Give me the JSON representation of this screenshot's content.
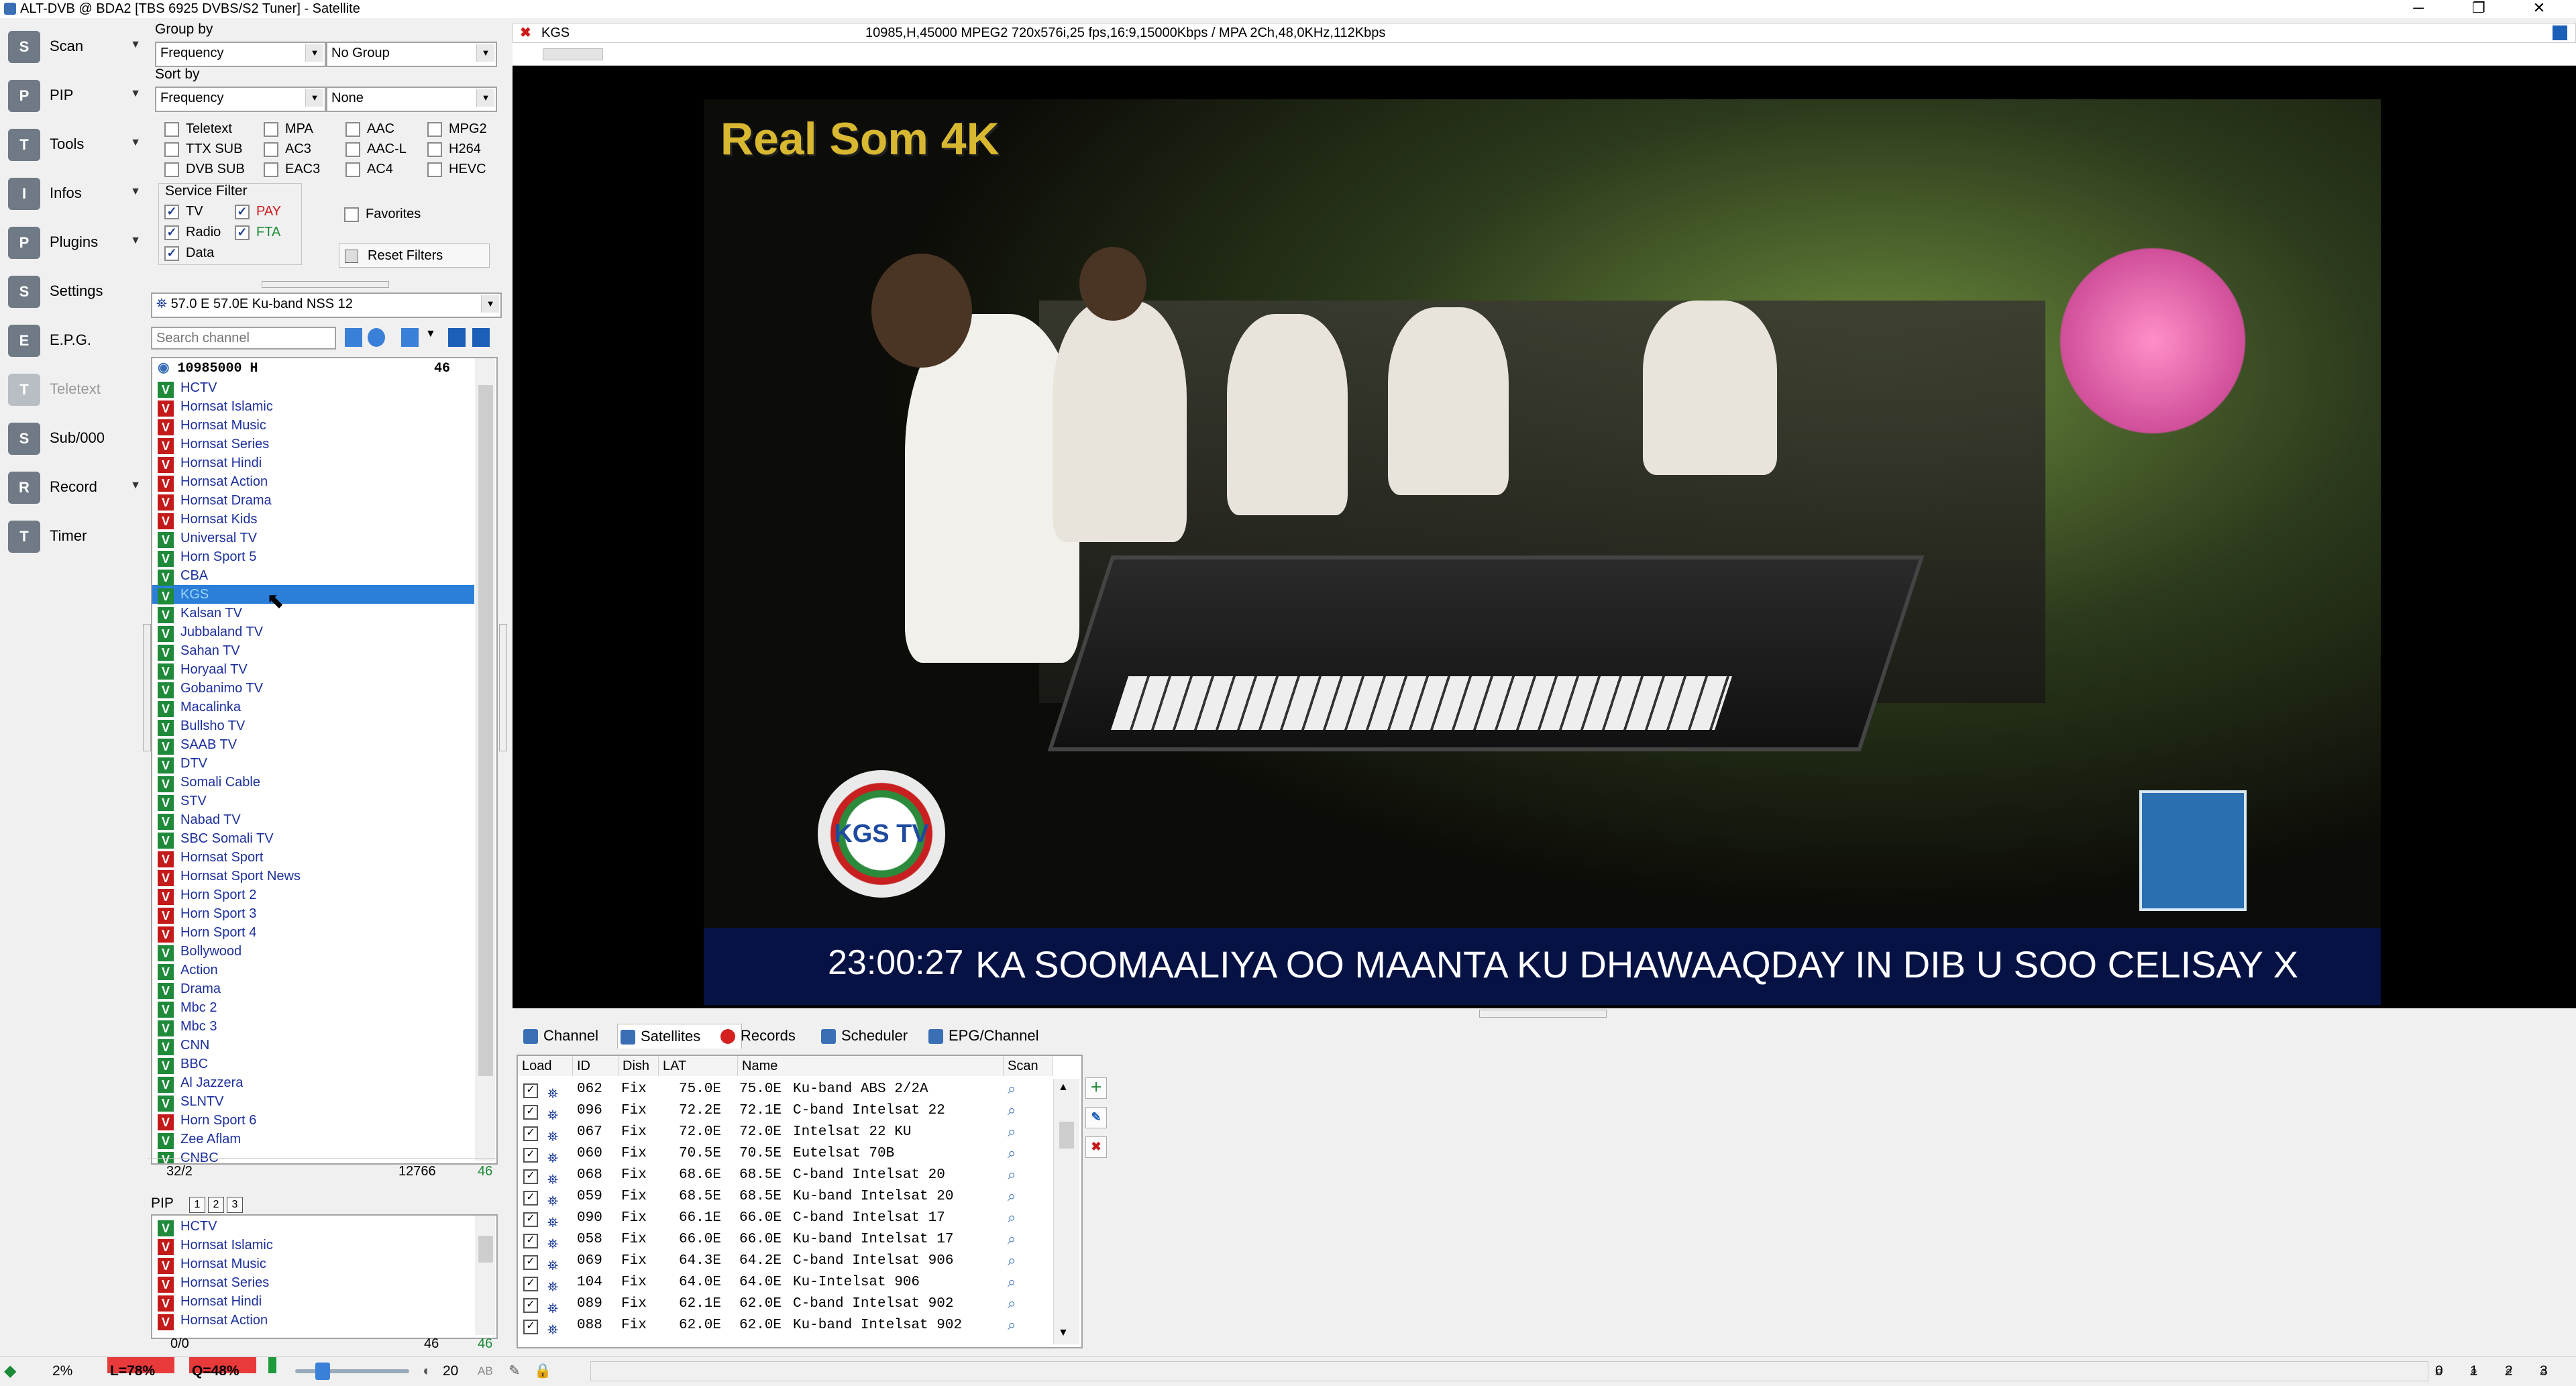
{
  "window": {
    "title": "ALT-DVB @ BDA2 [TBS 6925 DVBS/S2 Tuner] - Satellite"
  },
  "toolbar": [
    {
      "label": "Scan",
      "icon": "scan-icon",
      "arrow": "▼",
      "dim": false
    },
    {
      "label": "PIP",
      "icon": "pip-icon",
      "arrow": "▼",
      "dim": false
    },
    {
      "label": "Tools",
      "icon": "tools-icon",
      "arrow": "▼",
      "dim": false
    },
    {
      "label": "Infos",
      "icon": "info-icon",
      "arrow": "▼",
      "dim": false
    },
    {
      "label": "Plugins",
      "icon": "plugins-icon",
      "arrow": "▼",
      "dim": false
    },
    {
      "label": "Settings",
      "icon": "gear-icon",
      "arrow": "",
      "dim": false
    },
    {
      "label": "E.P.G.",
      "icon": "epg-icon",
      "arrow": "",
      "dim": false
    },
    {
      "label": "Teletext",
      "icon": "teletext-icon",
      "arrow": "",
      "dim": true
    },
    {
      "label": "Sub/000",
      "icon": "subtitle-icon",
      "arrow": "",
      "dim": false
    },
    {
      "label": "Record",
      "icon": "record-icon",
      "arrow": "▼",
      "dim": false
    },
    {
      "label": "Timer",
      "icon": "timer-icon",
      "arrow": "",
      "dim": false
    }
  ],
  "filters": {
    "group_by_label": "Group by",
    "group_by_value": "Frequency",
    "group_value2": "No Group",
    "sort_by_label": "Sort by",
    "sort_by_value": "Frequency",
    "sort_value2": "None",
    "checks": [
      {
        "label": "Teletext",
        "on": false
      },
      {
        "label": "MPA",
        "on": false
      },
      {
        "label": "AAC",
        "on": false
      },
      {
        "label": "MPG2",
        "on": false
      },
      {
        "label": "TTX SUB",
        "on": false
      },
      {
        "label": "AC3",
        "on": false
      },
      {
        "label": "AAC-L",
        "on": false
      },
      {
        "label": "H264",
        "on": false
      },
      {
        "label": "DVB SUB",
        "on": false
      },
      {
        "label": "EAC3",
        "on": false
      },
      {
        "label": "AC4",
        "on": false
      },
      {
        "label": "HEVC",
        "on": false
      }
    ],
    "service_filter_label": "Service Filter",
    "service": [
      {
        "label": "TV",
        "on": true,
        "color": ""
      },
      {
        "label": "PAY",
        "on": true,
        "color": "red"
      },
      {
        "label": "Radio",
        "on": true,
        "color": ""
      },
      {
        "label": "FTA",
        "on": true,
        "color": "grn"
      },
      {
        "label": "Data",
        "on": true,
        "color": ""
      }
    ],
    "favorites_label": "Favorites",
    "reset_label": "Reset Filters"
  },
  "satellite_select": "57.0 E 57.0E Ku-band NSS 12",
  "search_placeholder": "Search channel",
  "transponder": {
    "label": "10985000 H",
    "count": "46"
  },
  "channels": [
    {
      "name": "HCTV",
      "t": "v"
    },
    {
      "name": "Hornsat Islamic",
      "t": "r"
    },
    {
      "name": "Hornsat Music",
      "t": "r"
    },
    {
      "name": "Hornsat Series",
      "t": "r"
    },
    {
      "name": "Hornsat Hindi",
      "t": "r"
    },
    {
      "name": "Hornsat Action",
      "t": "r"
    },
    {
      "name": "Hornsat Drama",
      "t": "r"
    },
    {
      "name": "Hornsat Kids",
      "t": "r"
    },
    {
      "name": "Universal TV",
      "t": "v"
    },
    {
      "name": "Horn Sport 5",
      "t": "v"
    },
    {
      "name": "CBA",
      "t": "v"
    },
    {
      "name": "KGS",
      "t": "v"
    },
    {
      "name": "Kalsan TV",
      "t": "v"
    },
    {
      "name": "Jubbaland TV",
      "t": "v"
    },
    {
      "name": "Sahan TV",
      "t": "v"
    },
    {
      "name": "Horyaal TV",
      "t": "v"
    },
    {
      "name": "Gobanimo TV",
      "t": "v"
    },
    {
      "name": "Macalinka",
      "t": "v"
    },
    {
      "name": "Bullsho TV",
      "t": "v"
    },
    {
      "name": "SAAB TV",
      "t": "v"
    },
    {
      "name": "DTV",
      "t": "v"
    },
    {
      "name": "Somali Cable",
      "t": "v"
    },
    {
      "name": "STV",
      "t": "v"
    },
    {
      "name": "Nabad TV",
      "t": "v"
    },
    {
      "name": "SBC Somali TV",
      "t": "v"
    },
    {
      "name": "Hornsat Sport",
      "t": "r"
    },
    {
      "name": "Hornsat Sport News",
      "t": "r"
    },
    {
      "name": "Horn Sport 2",
      "t": "r"
    },
    {
      "name": "Horn Sport 3",
      "t": "r"
    },
    {
      "name": "Horn Sport 4",
      "t": "r"
    },
    {
      "name": "Bollywood",
      "t": "v"
    },
    {
      "name": "Action",
      "t": "v"
    },
    {
      "name": "Drama",
      "t": "v"
    },
    {
      "name": "Mbc 2",
      "t": "v"
    },
    {
      "name": "Mbc 3",
      "t": "v"
    },
    {
      "name": "CNN",
      "t": "v"
    },
    {
      "name": "BBC",
      "t": "v"
    },
    {
      "name": "Al Jazzera",
      "t": "v"
    },
    {
      "name": "SLNTV",
      "t": "v"
    },
    {
      "name": "Horn Sport 6",
      "t": "r"
    },
    {
      "name": "Zee Aflam",
      "t": "v"
    },
    {
      "name": "CNBC",
      "t": "v"
    }
  ],
  "selected_channel_index": 11,
  "list_status": {
    "left": "32/2",
    "mid": "12766",
    "right": "46"
  },
  "pip": {
    "label": "PIP",
    "buttons": [
      "1",
      "2",
      "3"
    ],
    "channels": [
      {
        "name": "HCTV",
        "t": "v"
      },
      {
        "name": "Hornsat Islamic",
        "t": "r"
      },
      {
        "name": "Hornsat Music",
        "t": "r"
      },
      {
        "name": "Hornsat Series",
        "t": "r"
      },
      {
        "name": "Hornsat Hindi",
        "t": "r"
      },
      {
        "name": "Hornsat Action",
        "t": "r"
      }
    ],
    "status": {
      "left": "0/0",
      "mid": "46",
      "right": "46"
    }
  },
  "video": {
    "channel": "KGS",
    "stream_info": "10985,H,45000  MPEG2 720x576i,25 fps,16:9,15000Kbps / MPA 2Ch,48,0KHz,112Kbps",
    "logo_text": "Real Som 4K",
    "kgs_logo": "KGS TV",
    "time": "23:00:27",
    "ticker": "KA SOOMAALIYA OO MAANTA KU DHAWAAQDAY IN DIB U SOO CELISAY X"
  },
  "tabs": [
    {
      "label": "Channel",
      "icon": "channel-icon",
      "active": false
    },
    {
      "label": "Satellites",
      "icon": "satellite-icon",
      "active": true
    },
    {
      "label": "Records",
      "icon": "record-icon",
      "active": false
    },
    {
      "label": "Scheduler",
      "icon": "scheduler-icon",
      "active": false
    },
    {
      "label": "EPG/Channel",
      "icon": "epg-icon",
      "active": false
    }
  ],
  "sat_table": {
    "headers": [
      "Load",
      "ID",
      "Dish",
      "LAT",
      "Name",
      "Scan"
    ],
    "rows": [
      {
        "id": "062",
        "dish": "Fix",
        "lat": "75.0E",
        "lat2": "75.0E",
        "name": "Ku-band ABS 2/2A"
      },
      {
        "id": "096",
        "dish": "Fix",
        "lat": "72.2E",
        "lat2": "72.1E",
        "name": "C-band Intelsat 22"
      },
      {
        "id": "067",
        "dish": "Fix",
        "lat": "72.0E",
        "lat2": "72.0E",
        "name": "Intelsat 22 KU"
      },
      {
        "id": "060",
        "dish": "Fix",
        "lat": "70.5E",
        "lat2": "70.5E",
        "name": "Eutelsat 70B"
      },
      {
        "id": "068",
        "dish": "Fix",
        "lat": "68.6E",
        "lat2": "68.5E",
        "name": "C-band Intelsat 20"
      },
      {
        "id": "059",
        "dish": "Fix",
        "lat": "68.5E",
        "lat2": "68.5E",
        "name": "Ku-band Intelsat 20"
      },
      {
        "id": "090",
        "dish": "Fix",
        "lat": "66.1E",
        "lat2": "66.0E",
        "name": "C-band Intelsat 17"
      },
      {
        "id": "058",
        "dish": "Fix",
        "lat": "66.0E",
        "lat2": "66.0E",
        "name": "Ku-band Intelsat 17"
      },
      {
        "id": "069",
        "dish": "Fix",
        "lat": "64.3E",
        "lat2": "64.2E",
        "name": "C-band Intelsat 906"
      },
      {
        "id": "104",
        "dish": "Fix",
        "lat": "64.0E",
        "lat2": "64.0E",
        "name": "Ku-Intelsat 906"
      },
      {
        "id": "089",
        "dish": "Fix",
        "lat": "62.1E",
        "lat2": "62.0E",
        "name": "C-band Intelsat 902"
      },
      {
        "id": "088",
        "dish": "Fix",
        "lat": "62.0E",
        "lat2": "62.0E",
        "name": "Ku-band Intelsat 902"
      }
    ]
  },
  "status_bar": {
    "signal_pct": "2%",
    "level": "L=78%",
    "quality": "Q=48%",
    "volume": "20",
    "audio": "AB",
    "zoom": [
      "0",
      "1",
      "2",
      "3"
    ]
  }
}
